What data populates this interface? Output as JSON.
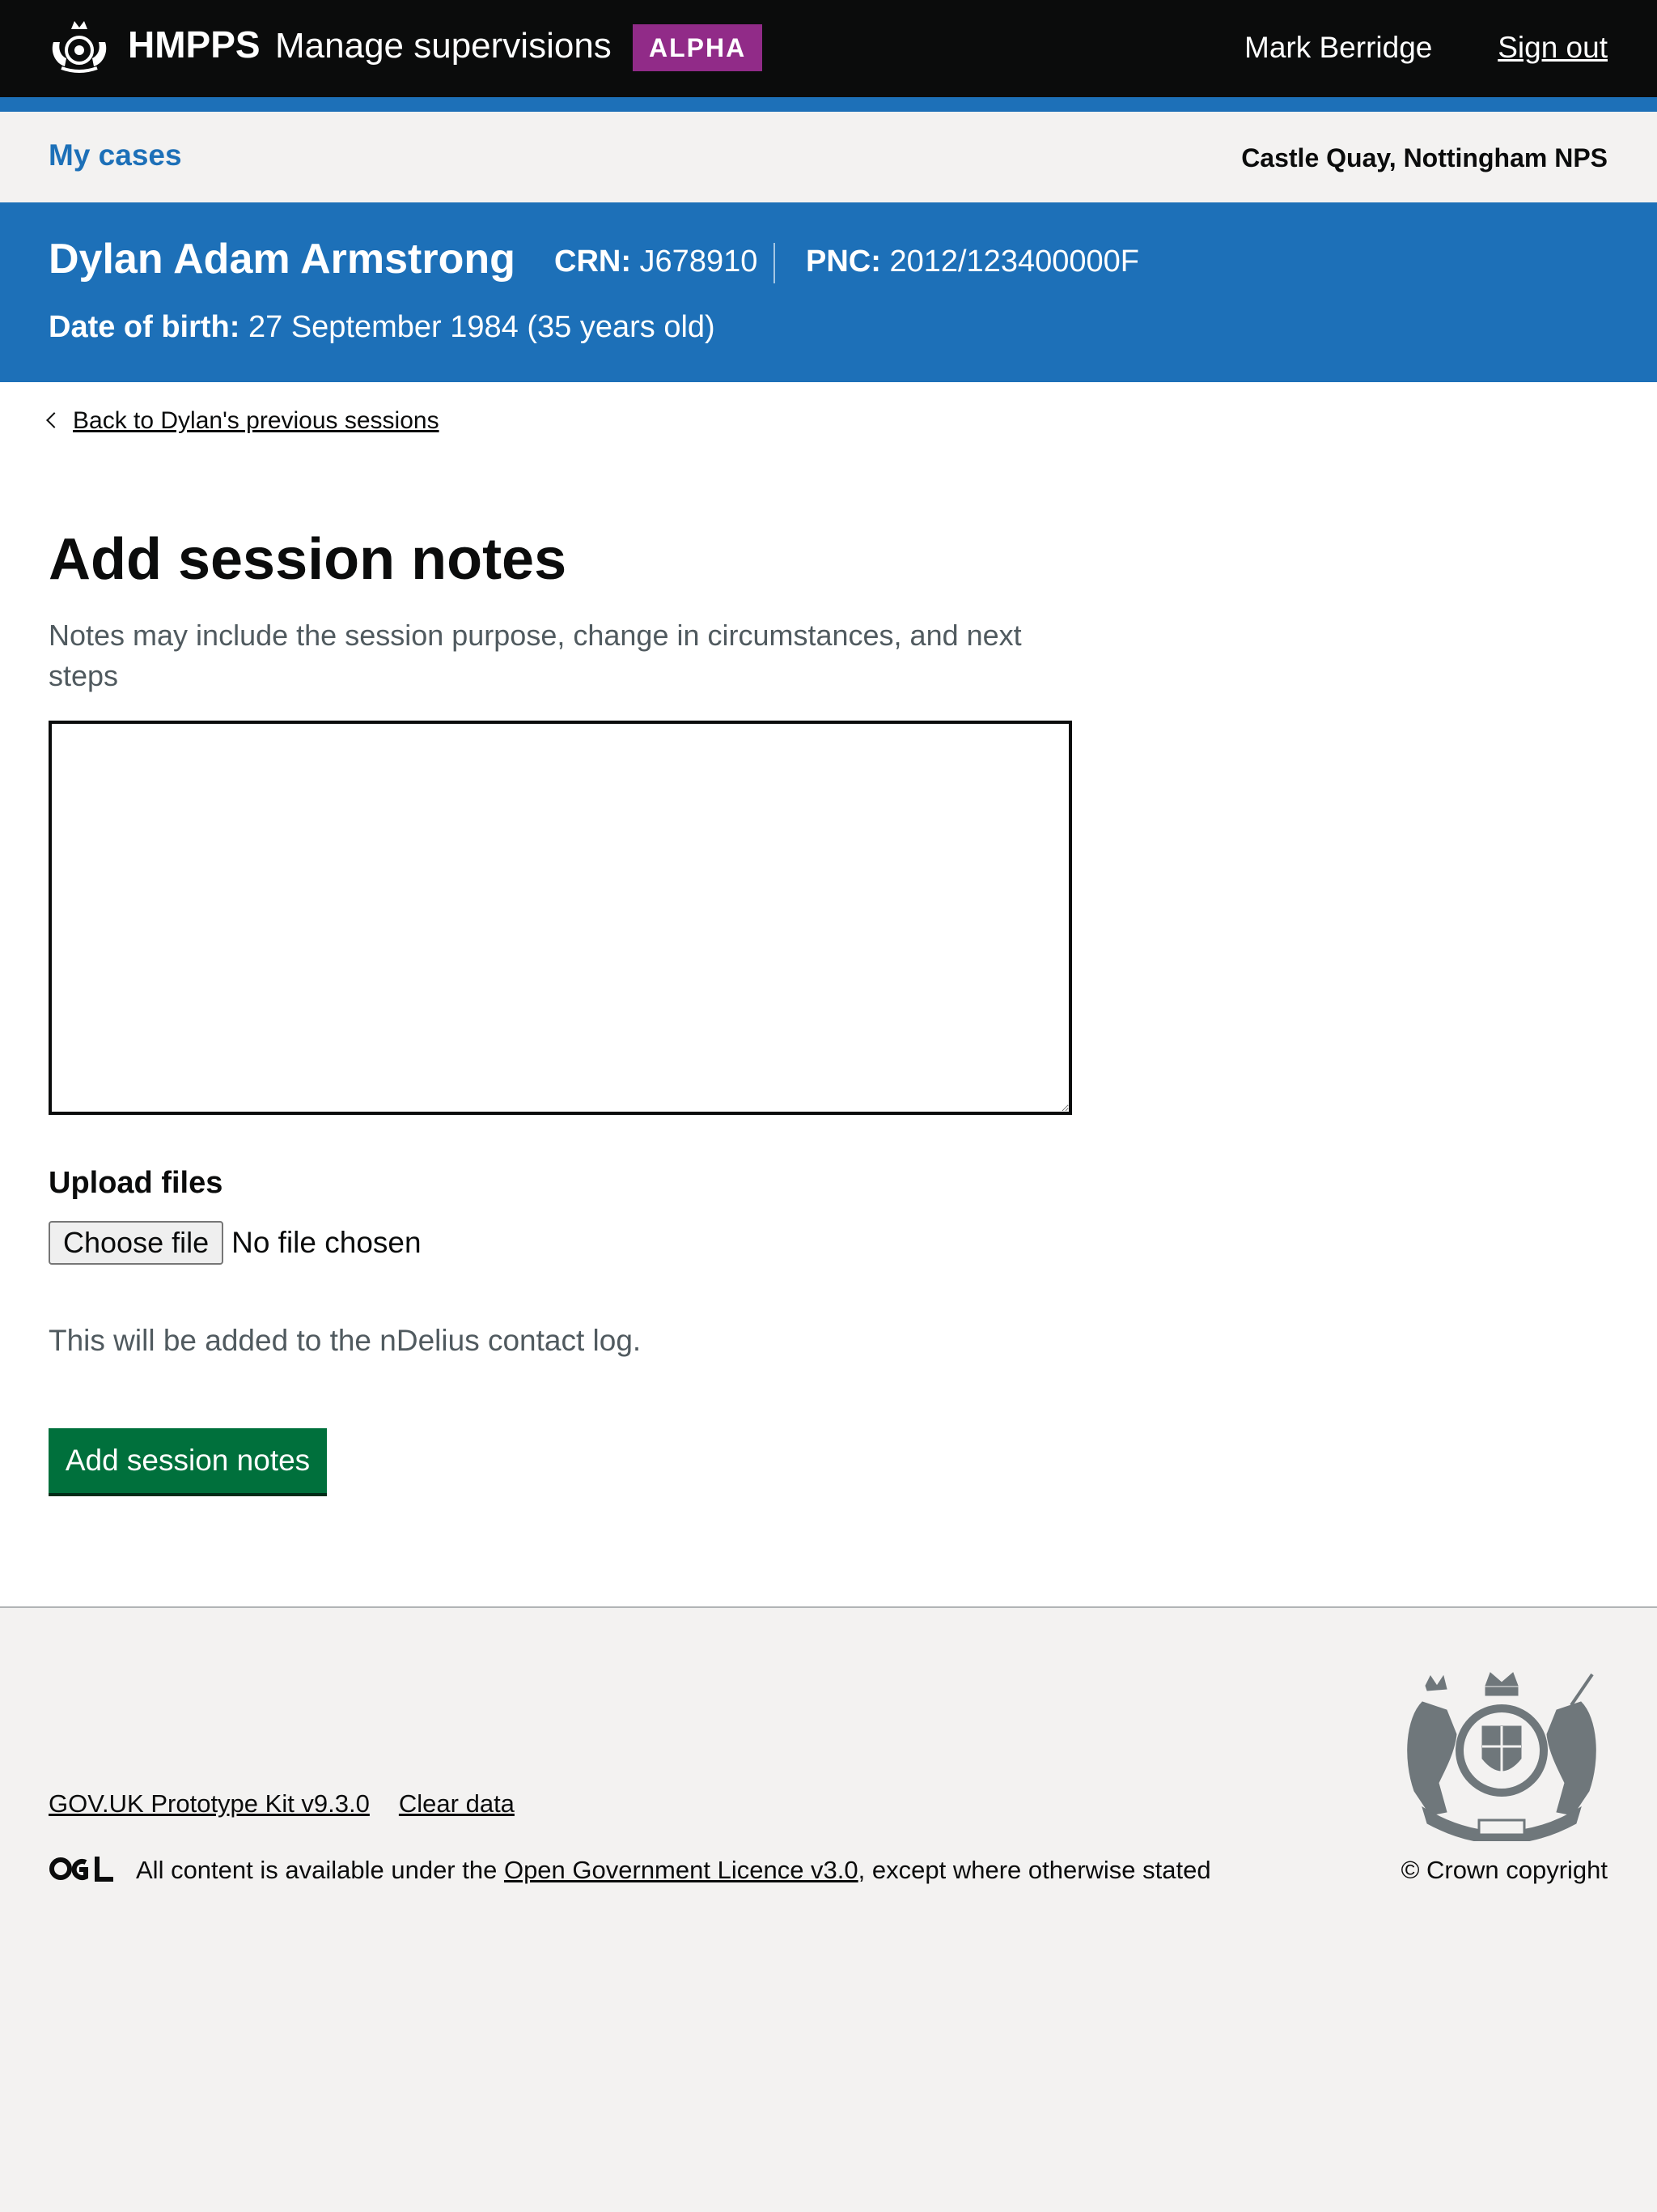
{
  "header": {
    "brand": "HMPPS",
    "service": "Manage supervisions",
    "tag": "ALPHA",
    "user": "Mark Berridge",
    "sign_out": "Sign out"
  },
  "subnav": {
    "my_cases": "My cases",
    "location": "Castle Quay, Nottingham NPS"
  },
  "person": {
    "name": "Dylan Adam Armstrong",
    "crn_label": "CRN:",
    "crn": "J678910",
    "pnc_label": "PNC:",
    "pnc": "2012/123400000F",
    "dob_label": "Date of birth:",
    "dob": "27 September 1984 (35 years old)"
  },
  "main": {
    "back_link": "Back to Dylan's previous sessions",
    "title": "Add session notes",
    "hint": "Notes may include the session purpose, change in circumstances, and next steps",
    "notes_value": "",
    "upload_label": "Upload files",
    "choose_file": "Choose file",
    "no_file": "No file chosen",
    "info": "This will be added to the nDelius contact log.",
    "submit": "Add session notes"
  },
  "footer": {
    "kit_link": "GOV.UK Prototype Kit v9.3.0",
    "clear_data": "Clear data",
    "licence_prefix": "All content is available under the ",
    "licence_link": "Open Government Licence v3.0",
    "licence_suffix": ", except where otherwise stated",
    "copyright": "© Crown copyright"
  },
  "icons": {
    "crest": "royal-crest-icon",
    "ogl": "ogl-logo-icon",
    "back": "chevron-left-icon"
  },
  "colors": {
    "header_bg": "#0b0c0c",
    "blue": "#1d70b8",
    "tag_purple": "#912b88",
    "button_green": "#00703c",
    "footer_bg": "#f3f2f1",
    "secondary_text": "#505a5f"
  }
}
